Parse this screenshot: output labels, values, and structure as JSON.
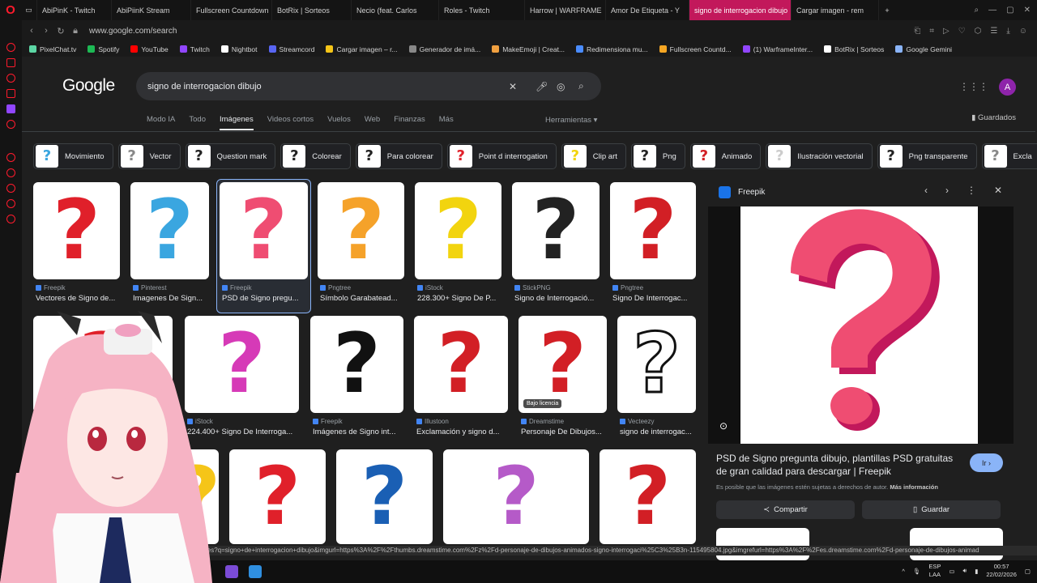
{
  "browser": {
    "tabs": [
      {
        "label": "AbiPinK - Twitch",
        "color": "#9146ff"
      },
      {
        "label": "AbiPiinK Stream",
        "color": "#53fc18"
      },
      {
        "label": "Fullscreen Countdown",
        "color": "#f5a623"
      },
      {
        "label": "BotRix | Sorteos",
        "color": "#ffffff"
      },
      {
        "label": "Necio (feat. Carlos",
        "color": "#1db954"
      },
      {
        "label": "Roles - Twitch",
        "color": "#9146ff"
      },
      {
        "label": "Harrow | WARFRAME",
        "color": "#ffffff"
      },
      {
        "label": "Amor De Etiqueta - Y",
        "color": "#ff0000"
      },
      {
        "label": "signo de interrogacion dibujo",
        "color": "#4285f4",
        "active": true
      },
      {
        "label": "Cargar imagen - rem",
        "color": "#f5c518"
      }
    ],
    "url": "www.google.com/search",
    "bookmarks": [
      {
        "label": "PixelChat.tv",
        "color": "#5cd6a4"
      },
      {
        "label": "Spotify",
        "color": "#1db954"
      },
      {
        "label": "YouTube",
        "color": "#ff0000"
      },
      {
        "label": "Twitch",
        "color": "#9146ff"
      },
      {
        "label": "Nightbot",
        "color": "#ffffff"
      },
      {
        "label": "Streamcord",
        "color": "#5865f2"
      },
      {
        "label": "Cargar imagen – r...",
        "color": "#f5c518"
      },
      {
        "label": "Generador de imá...",
        "color": "#888888"
      },
      {
        "label": "MakeEmoji | Creat...",
        "color": "#f0a040"
      },
      {
        "label": "Redimensiona mu...",
        "color": "#4a8cff"
      },
      {
        "label": "Fullscreen Countd...",
        "color": "#f5a623"
      },
      {
        "label": "(1) WarframeInter...",
        "color": "#9146ff"
      },
      {
        "label": "BotRix | Sorteos",
        "color": "#ffffff"
      },
      {
        "label": "Google Gemini",
        "color": "#8ab4f8"
      }
    ]
  },
  "google": {
    "logo": "Google",
    "query": "signo de interrogacion dibujo",
    "account_initial": "A",
    "tabs": [
      "Modo IA",
      "Todo",
      "Imágenes",
      "Videos cortos",
      "Vuelos",
      "Web",
      "Finanzas",
      "Más"
    ],
    "active_tab": "Imágenes",
    "tools": "Herramientas",
    "saved": "Guardados",
    "chips": [
      "Movimiento",
      "Vector",
      "Question mark",
      "Colorear",
      "Para colorear",
      "Point d interrogation",
      "Clip art",
      "Png",
      "Animado",
      "Ilustración vectorial",
      "Png transparente",
      "Excla"
    ],
    "results_row1": [
      {
        "source": "Freepik",
        "title": "Vectores de Signo de...",
        "color": "#e0202a"
      },
      {
        "source": "Pinterest",
        "title": "Imagenes De Sign...",
        "color": "#3aa6e0"
      },
      {
        "source": "Freepik",
        "title": "PSD de Signo pregu...",
        "color": "#ef4d72",
        "selected": true
      },
      {
        "source": "Pngtree",
        "title": "Símbolo Garabatead...",
        "color": "#f5a22a"
      },
      {
        "source": "iStock",
        "title": "228.300+ Signo De P...",
        "color": "#f2d40f"
      },
      {
        "source": "StickPNG",
        "title": "Signo de Interrogació...",
        "color": "#222222"
      },
      {
        "source": "Pngtree",
        "title": "Signo De Interrogac...",
        "color": "#d21f25"
      }
    ],
    "results_row2": [
      {
        "source": "",
        "title": "",
        "color": "#e0202a"
      },
      {
        "source": "iStock",
        "title": "224.400+ Signo De Interroga...",
        "color": "#d63ab7"
      },
      {
        "source": "Freepik",
        "title": "Imágenes de Signo int...",
        "color": "#111111"
      },
      {
        "source": "Illustoon",
        "title": "Exclamación y signo d...",
        "color": "#d21f25"
      },
      {
        "source": "Dreamstime",
        "title": "Personaje De Dibujos...",
        "color": "#d21f25",
        "badge": "Bajo licencia"
      },
      {
        "source": "Vecteezy",
        "title": "signo de interrogac...",
        "color": "#ffffff"
      }
    ],
    "results_row3": [
      {
        "color": "#f5c518"
      },
      {
        "color": "#e0202a"
      },
      {
        "color": "#1a5fb4"
      },
      {
        "color": "#b55ac8"
      },
      {
        "color": "#d21f25"
      }
    ],
    "panel": {
      "source": "Freepik",
      "title": "PSD de Signo pregunta dibujo, plantillas PSD gratuitas de gran calidad para descargar | Freepik",
      "visit": "Ir",
      "note": "Es posible que las imágenes estén sujetas a derechos de autor.",
      "more_info": "Más información",
      "share": "Compartir",
      "save": "Guardar"
    }
  },
  "status_url": "/imgres?q=signo+de+interrogacion+dibujo&imgurl=https%3A%2F%2Fthumbs.dreamstime.com%2Fz%2Fd-personaje-de-dibujos-animados-signo-interrogaci%25C3%25B3n-115495804.jpg&imgrefurl=https%3A%2F%2Fes.dreamstime.com%2Fd-personaje-de-dibujos-animad",
  "taskbar": {
    "lang": "ESP",
    "lang_sub": "LAA",
    "time": "00:57",
    "date": "22/02/2026"
  }
}
